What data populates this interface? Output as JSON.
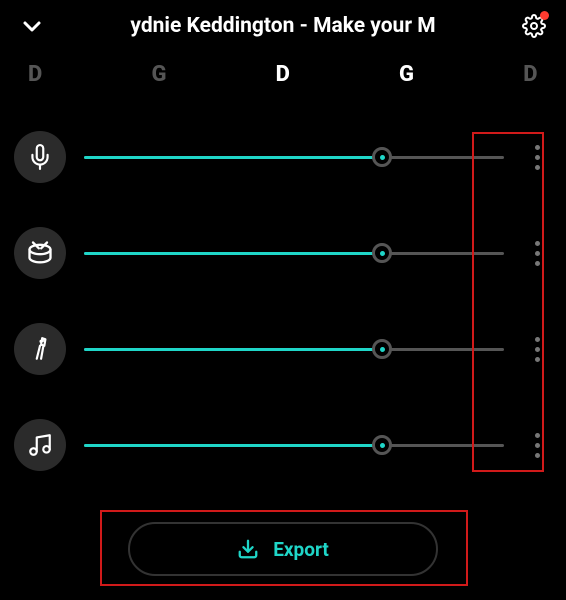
{
  "header": {
    "title": "ydnie Keddington - Make your M"
  },
  "colors": {
    "accent": "#1fd6c8",
    "notification": "#ff3b30",
    "highlight": "#d11a1a"
  },
  "chords": {
    "items": [
      "D",
      "G",
      "D",
      "G",
      "D"
    ],
    "bright_indices": [
      2,
      3
    ]
  },
  "tracks": [
    {
      "id": "vocals",
      "icon": "mic",
      "value": 71
    },
    {
      "id": "drums",
      "icon": "drum",
      "value": 71
    },
    {
      "id": "bass",
      "icon": "guitar",
      "value": 71
    },
    {
      "id": "other",
      "icon": "music",
      "value": 71
    }
  ],
  "export": {
    "label": "Export"
  }
}
